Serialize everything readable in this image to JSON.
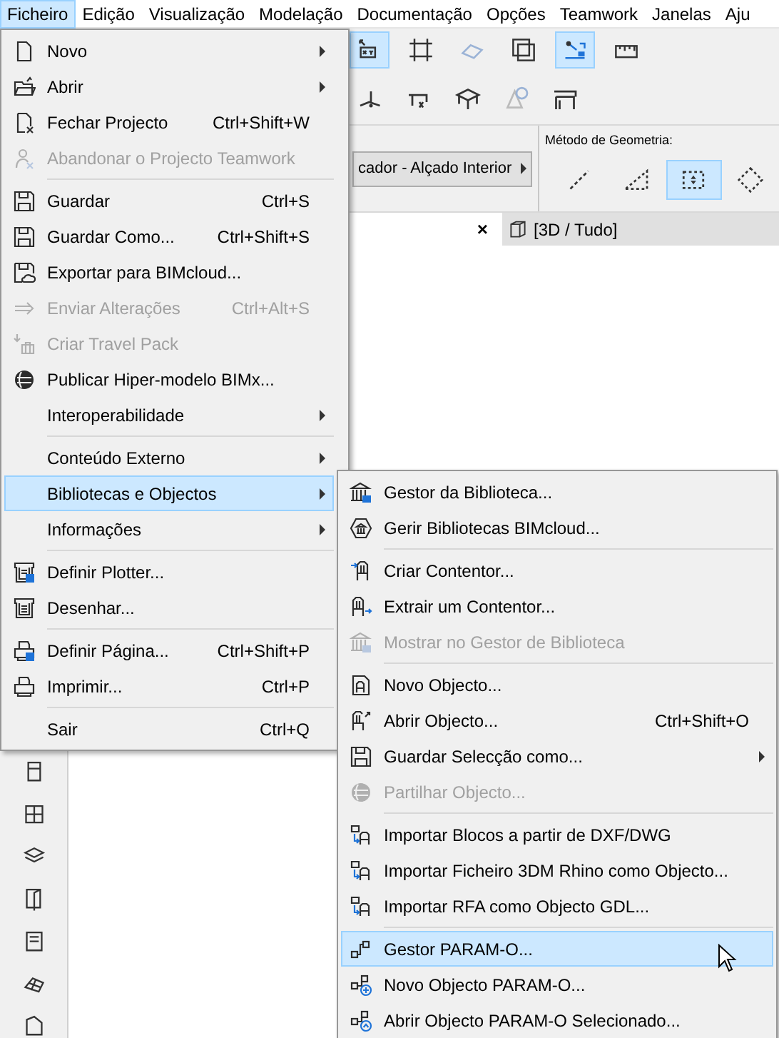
{
  "menubar": [
    {
      "label": "Ficheiro",
      "selected": true
    },
    {
      "label": "Edição",
      "selected": false
    },
    {
      "label": "Visualização",
      "selected": false
    },
    {
      "label": "Modelação",
      "selected": false
    },
    {
      "label": "Documentação",
      "selected": false
    },
    {
      "label": "Opções",
      "selected": false
    },
    {
      "label": "Teamwork",
      "selected": false
    },
    {
      "label": "Janelas",
      "selected": false
    },
    {
      "label": "Aju",
      "selected": false
    }
  ],
  "toolbar": {
    "buttons": [
      {
        "selected": true
      },
      {
        "selected": false
      },
      {
        "selected": false
      },
      {
        "selected": false
      },
      {
        "selected": true
      },
      {
        "selected": false
      }
    ],
    "view_button": "cador - Alçado Interior",
    "geometry_label": "Método de Geometria:",
    "geometry_methods": [
      {
        "selected": false
      },
      {
        "selected": false
      },
      {
        "selected": true
      },
      {
        "selected": false
      }
    ]
  },
  "tabs": {
    "close": "×",
    "tab": "[3D / Tudo]"
  },
  "file_menu": [
    {
      "kind": "item",
      "label": "Novo",
      "submenu": true,
      "disabled": false,
      "selected": false
    },
    {
      "kind": "item",
      "label": "Abrir",
      "submenu": true,
      "disabled": false,
      "selected": false
    },
    {
      "kind": "item",
      "label": "Fechar Projecto",
      "shortcut": "Ctrl+Shift+W",
      "submenu": false,
      "disabled": false,
      "selected": false
    },
    {
      "kind": "item",
      "label": "Abandonar o Projecto Teamwork",
      "submenu": false,
      "disabled": true,
      "selected": false
    },
    {
      "kind": "separator"
    },
    {
      "kind": "item",
      "label": "Guardar",
      "shortcut": "Ctrl+S",
      "submenu": false,
      "disabled": false,
      "selected": false
    },
    {
      "kind": "item",
      "label": "Guardar Como...",
      "shortcut": "Ctrl+Shift+S",
      "submenu": false,
      "disabled": false,
      "selected": false
    },
    {
      "kind": "item",
      "label": "Exportar para BIMcloud...",
      "submenu": false,
      "disabled": false,
      "selected": false
    },
    {
      "kind": "item",
      "label": "Enviar Alterações",
      "shortcut": "Ctrl+Alt+S",
      "submenu": false,
      "disabled": true,
      "selected": false
    },
    {
      "kind": "item",
      "label": "Criar Travel Pack",
      "submenu": false,
      "disabled": true,
      "selected": false
    },
    {
      "kind": "item",
      "label": "Publicar Hiper-modelo BIMx...",
      "submenu": false,
      "disabled": false,
      "selected": false
    },
    {
      "kind": "item",
      "label": "Interoperabilidade",
      "submenu": true,
      "disabled": false,
      "selected": false
    },
    {
      "kind": "separator"
    },
    {
      "kind": "item",
      "label": "Conteúdo Externo",
      "submenu": true,
      "disabled": false,
      "selected": false
    },
    {
      "kind": "item",
      "label": "Bibliotecas e Objectos",
      "submenu": true,
      "disabled": false,
      "selected": true
    },
    {
      "kind": "item",
      "label": "Informações",
      "submenu": true,
      "disabled": false,
      "selected": false
    },
    {
      "kind": "separator"
    },
    {
      "kind": "item",
      "label": "Definir Plotter...",
      "submenu": false,
      "disabled": false,
      "selected": false
    },
    {
      "kind": "item",
      "label": "Desenhar...",
      "submenu": false,
      "disabled": false,
      "selected": false
    },
    {
      "kind": "separator"
    },
    {
      "kind": "item",
      "label": "Definir Página...",
      "shortcut": "Ctrl+Shift+P",
      "submenu": false,
      "disabled": false,
      "selected": false
    },
    {
      "kind": "item",
      "label": "Imprimir...",
      "shortcut": "Ctrl+P",
      "submenu": false,
      "disabled": false,
      "selected": false
    },
    {
      "kind": "separator"
    },
    {
      "kind": "item",
      "label": "Sair",
      "shortcut": "Ctrl+Q",
      "submenu": false,
      "disabled": false,
      "selected": false
    }
  ],
  "library_submenu": [
    {
      "kind": "item",
      "label": "Gestor da Biblioteca...",
      "submenu": false,
      "disabled": false,
      "selected": false
    },
    {
      "kind": "item",
      "label": "Gerir Bibliotecas BIMcloud...",
      "submenu": false,
      "disabled": false,
      "selected": false
    },
    {
      "kind": "separator"
    },
    {
      "kind": "item",
      "label": "Criar Contentor...",
      "submenu": false,
      "disabled": false,
      "selected": false
    },
    {
      "kind": "item",
      "label": "Extrair um Contentor...",
      "submenu": false,
      "disabled": false,
      "selected": false
    },
    {
      "kind": "item",
      "label": "Mostrar no Gestor de Biblioteca",
      "submenu": false,
      "disabled": true,
      "selected": false
    },
    {
      "kind": "separator"
    },
    {
      "kind": "item",
      "label": "Novo Objecto...",
      "submenu": false,
      "disabled": false,
      "selected": false
    },
    {
      "kind": "item",
      "label": "Abrir Objecto...",
      "shortcut": "Ctrl+Shift+O",
      "submenu": false,
      "disabled": false,
      "selected": false
    },
    {
      "kind": "item",
      "label": "Guardar Selecção como...",
      "submenu": true,
      "disabled": false,
      "selected": false
    },
    {
      "kind": "item",
      "label": "Partilhar Objecto...",
      "submenu": false,
      "disabled": true,
      "selected": false
    },
    {
      "kind": "separator"
    },
    {
      "kind": "item",
      "label": "Importar Blocos a partir de DXF/DWG",
      "submenu": false,
      "disabled": false,
      "selected": false
    },
    {
      "kind": "item",
      "label": "Importar Ficheiro 3DM Rhino como Objecto...",
      "submenu": false,
      "disabled": false,
      "selected": false
    },
    {
      "kind": "item",
      "label": "Importar RFA como Objecto GDL...",
      "submenu": false,
      "disabled": false,
      "selected": false
    },
    {
      "kind": "separator"
    },
    {
      "kind": "item",
      "label": "Gestor PARAM-O...",
      "submenu": false,
      "disabled": false,
      "selected": true
    },
    {
      "kind": "item",
      "label": "Novo Objecto PARAM-O...",
      "submenu": false,
      "disabled": false,
      "selected": false
    },
    {
      "kind": "item",
      "label": "Abrir Objecto PARAM-O Selecionado...",
      "submenu": false,
      "disabled": false,
      "selected": false
    }
  ]
}
